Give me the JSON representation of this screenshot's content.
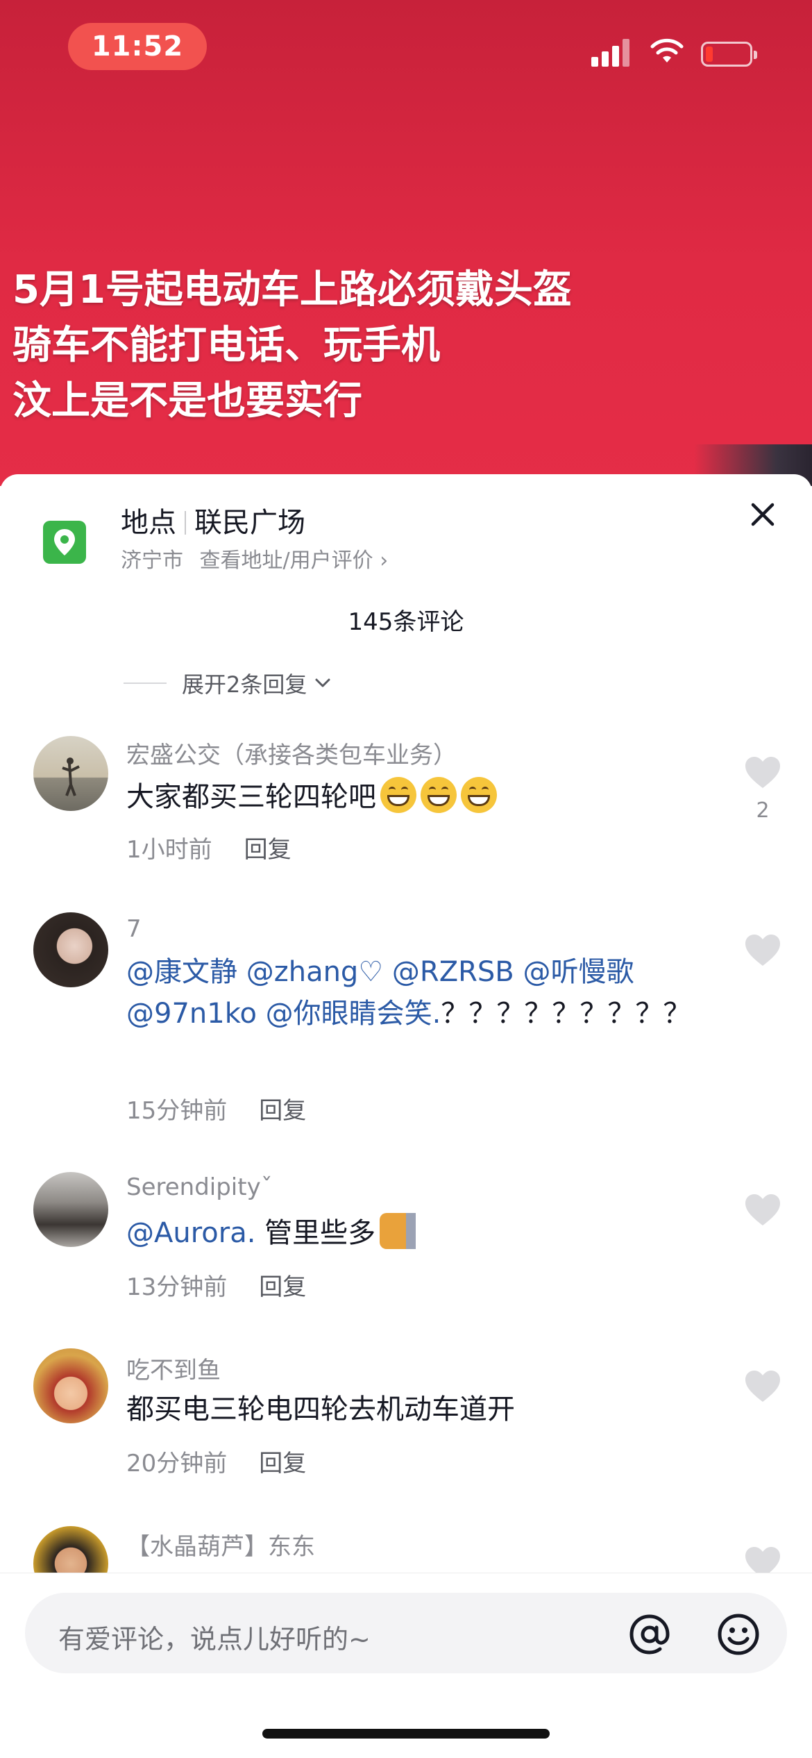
{
  "status_bar": {
    "time": "11:52"
  },
  "video": {
    "headline_lines": [
      "5月1号起电动车上路必须戴头盔",
      "骑车不能打电话、玩手机",
      "汶上是不是也要实行"
    ]
  },
  "location": {
    "label": "地点",
    "name": "联民广场",
    "city": "济宁市",
    "link": "查看地址/用户评价 ›"
  },
  "comments_count": "145条评论",
  "expand_replies": "展开2条回复",
  "comments": [
    {
      "name": "宏盛公交（承接各类包车业务）",
      "text": "大家都买三轮四轮吧",
      "time": "1小时前",
      "reply": "回复",
      "likes": "2"
    },
    {
      "name": "7",
      "text_parts": [
        "@康文静",
        "@zhang♡",
        "@RZRSB",
        "@听慢歌",
        "@97n1ko",
        "@你眼睛会笑.",
        "？？？？？？？？？"
      ],
      "time": "15分钟前",
      "reply": "回复"
    },
    {
      "name": "Serendipityˇ",
      "mention": "@Aurora.",
      "text": "管里些多",
      "time": "13分钟前",
      "reply": "回复"
    },
    {
      "name": "吃不到鱼",
      "text": "都买电三轮电四轮去机动车道开",
      "time": "20分钟前",
      "reply": "回复"
    },
    {
      "name": "【水晶葫芦】东东"
    }
  ],
  "input": {
    "placeholder": "有爱评论，说点儿好听的~"
  },
  "icons": {
    "location": "location-pin-icon",
    "close": "close-icon",
    "like": "heart-icon",
    "at": "at-icon",
    "emoji": "smiley-icon"
  },
  "colors": {
    "brand_red": "#e02a44",
    "mention_blue": "#2b5aa6",
    "pin_green": "#3bb54a"
  }
}
